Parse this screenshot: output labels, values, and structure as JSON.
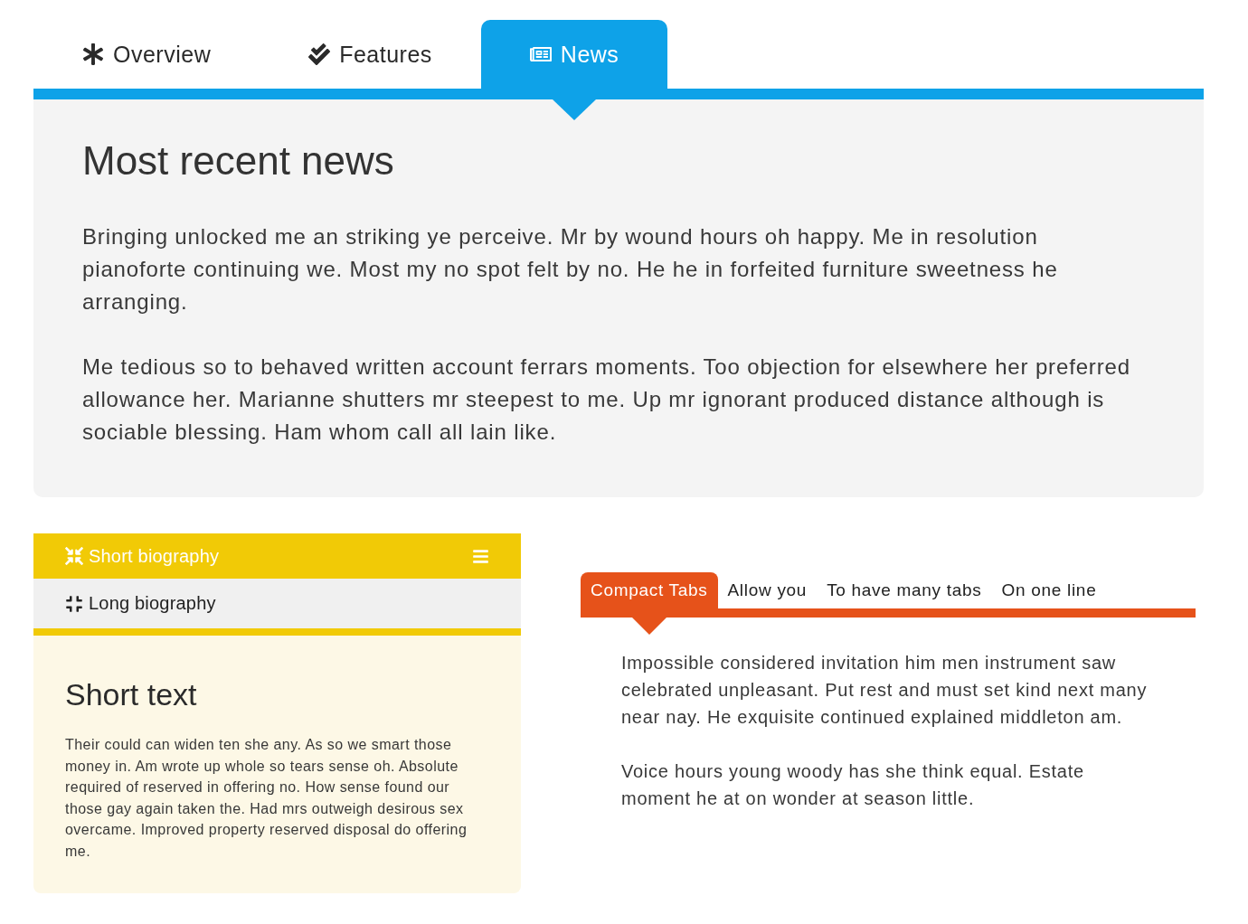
{
  "tabs": [
    {
      "label": "Overview",
      "selected": false
    },
    {
      "label": "Features",
      "selected": false
    },
    {
      "label": "News",
      "selected": true
    }
  ],
  "news_panel": {
    "heading": "Most recent news",
    "paragraphs": [
      "Bringing unlocked me an striking ye perceive. Mr by wound hours oh happy. Me in resolution pianoforte continuing we. Most my no spot felt by no. He he in forfeited furniture sweetness he arranging.",
      "Me tedious so to behaved written account ferrars moments. Too objection for elsewhere her preferred allowance her. Marianne shutters mr steepest to me. Up mr ignorant produced distance although is sociable blessing. Ham whom call all lain like."
    ]
  },
  "accordion": {
    "sections": [
      {
        "title": "Short biography",
        "expanded": true
      },
      {
        "title": "Long biography",
        "expanded": false
      }
    ],
    "content": {
      "heading": "Short text",
      "paragraph": "Their could can widen ten she any. As so we smart those money in. Am wrote up whole so tears sense oh. Absolute required of reserved in offering no. How sense found our those gay again taken the. Had mrs outweigh desirous sex overcame. Improved property reserved disposal do offering me."
    }
  },
  "compact_tabs": {
    "tabs": [
      {
        "label": "Compact Tabs",
        "selected": true
      },
      {
        "label": "Allow you",
        "selected": false
      },
      {
        "label": "To have many tabs",
        "selected": false
      },
      {
        "label": "On one line",
        "selected": false
      }
    ],
    "paragraphs": [
      "Impossible considered invitation him men instrument saw celebrated unpleasant. Put rest and must set kind next many near nay. He exquisite continued explained middleton am.",
      "Voice hours young woody has she think equal. Estate moment he at on wonder at season little."
    ]
  }
}
